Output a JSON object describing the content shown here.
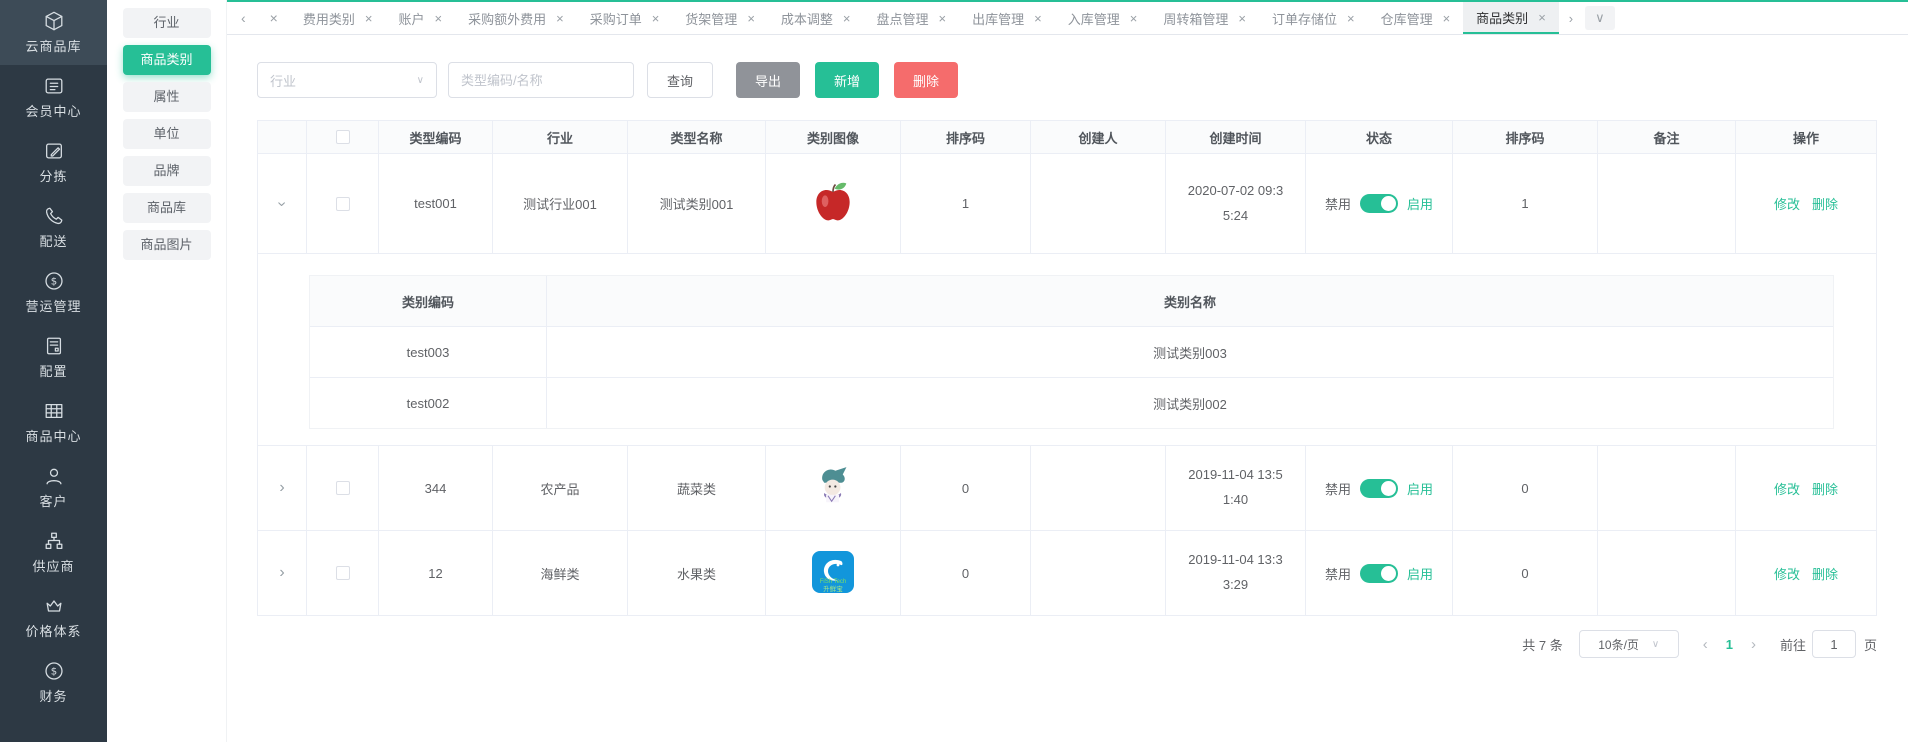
{
  "colors": {
    "accent_teal": "#26bf96",
    "danger_red": "#f56c6c",
    "neutral_gray": "#909399",
    "sidebar_dark": "#2d3944",
    "logo_blue": "#1296db"
  },
  "app_nav": {
    "items": [
      {
        "label": "云商品库",
        "icon": "cube-icon",
        "active": true
      },
      {
        "label": "会员中心",
        "icon": "member-card-icon",
        "active": false
      },
      {
        "label": "分拣",
        "icon": "edit-icon",
        "active": false
      },
      {
        "label": "配送",
        "icon": "phone-icon",
        "active": false
      },
      {
        "label": "营运管理",
        "icon": "dollar-circle-icon",
        "active": false
      },
      {
        "label": "配置",
        "icon": "server-icon",
        "active": false
      },
      {
        "label": "商品中心",
        "icon": "grid-icon",
        "active": false
      },
      {
        "label": "客户",
        "icon": "user-icon",
        "active": false
      },
      {
        "label": "供应商",
        "icon": "org-chart-icon",
        "active": false
      },
      {
        "label": "价格体系",
        "icon": "crown-icon",
        "active": false
      },
      {
        "label": "财务",
        "icon": "finance-dollar-icon",
        "active": false
      }
    ]
  },
  "sub_nav": {
    "items": [
      {
        "label": "行业",
        "active": false
      },
      {
        "label": "商品类别",
        "active": true
      },
      {
        "label": "属性",
        "active": false
      },
      {
        "label": "单位",
        "active": false
      },
      {
        "label": "品牌",
        "active": false
      },
      {
        "label": "商品库",
        "active": false
      },
      {
        "label": "商品图片",
        "active": false
      }
    ]
  },
  "tab_bar": {
    "left_chevron": "‹",
    "close_all_icon": "×",
    "close_icon": "×",
    "right_chevron": "›",
    "dropdown_chevron": "∨",
    "tabs": [
      {
        "label": "费用类别",
        "active": false
      },
      {
        "label": "账户",
        "active": false
      },
      {
        "label": "采购额外费用",
        "active": false
      },
      {
        "label": "采购订单",
        "active": false
      },
      {
        "label": "货架管理",
        "active": false
      },
      {
        "label": "成本调整",
        "active": false
      },
      {
        "label": "盘点管理",
        "active": false
      },
      {
        "label": "出库管理",
        "active": false
      },
      {
        "label": "入库管理",
        "active": false
      },
      {
        "label": "周转箱管理",
        "active": false
      },
      {
        "label": "订单存储位",
        "active": false
      },
      {
        "label": "仓库管理",
        "active": false
      },
      {
        "label": "商品类别",
        "active": true
      }
    ]
  },
  "filters": {
    "industry_placeholder": "行业",
    "keyword_placeholder": "类型编码/名称",
    "search_label": "查询",
    "export_label": "导出",
    "add_label": "新增",
    "delete_label": "删除"
  },
  "table": {
    "headers": [
      "",
      "",
      "类型编码",
      "行业",
      "类型名称",
      "类别图像",
      "排序码",
      "创建人",
      "创建时间",
      "状态",
      "排序码",
      "备注",
      "操作"
    ],
    "status_off_label": "禁用",
    "status_on_label": "启用",
    "edit_label": "修改",
    "remove_label": "删除",
    "rows": [
      {
        "expanded": true,
        "code": "test001",
        "industry": "测试行业001",
        "name": "测试类别001",
        "image": "apple-image",
        "sort": "1",
        "creator": "",
        "created": "2020-07-02 09:35:24",
        "sort2": "1",
        "remark": ""
      },
      {
        "expanded": false,
        "code": "344",
        "industry": "农产品",
        "name": "蔬菜类",
        "image": "mascot-image",
        "sort": "0",
        "creator": "",
        "created": "2019-11-04 13:51:40",
        "sort2": "0",
        "remark": ""
      },
      {
        "expanded": false,
        "code": "12",
        "industry": "海鲜类",
        "name": "水果类",
        "image": "fishtech-logo-image",
        "sort": "0",
        "creator": "",
        "created": "2019-11-04 13:33:29",
        "sort2": "0",
        "remark": ""
      }
    ],
    "sub_table": {
      "headers": [
        "类别编码",
        "类别名称"
      ],
      "rows": [
        [
          "test003",
          "测试类别003"
        ],
        [
          "test002",
          "测试类别002"
        ]
      ]
    }
  },
  "pagination": {
    "total": "共 7 条",
    "page_size": "10条/页",
    "current_page": "1",
    "goto_label": "前往",
    "goto_value": "1",
    "page_label": "页"
  }
}
